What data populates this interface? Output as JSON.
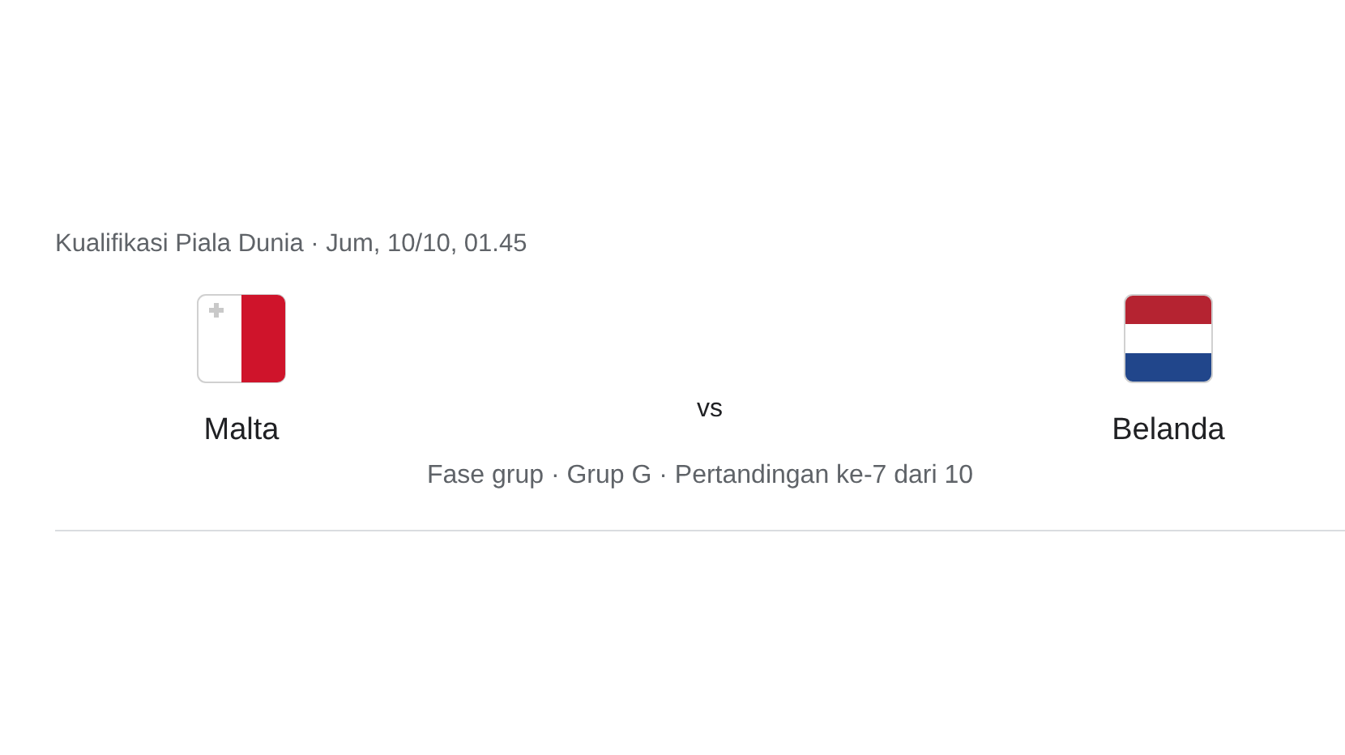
{
  "header": "Kualifikasi Piala Dunia · Jum, 10/10, 01.45",
  "teams": [
    {
      "name": "Malta",
      "kind": "malta"
    },
    {
      "name": "Belanda",
      "kind": "netherlands"
    }
  ],
  "versus": "vs",
  "details": "Fase grup · Grup G · Pertandingan ke-7 dari 10"
}
